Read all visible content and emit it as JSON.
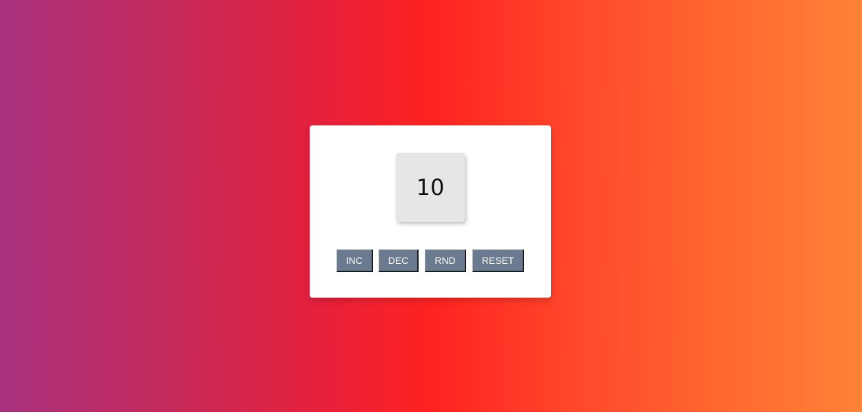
{
  "counter": {
    "value": "10"
  },
  "buttons": {
    "inc_label": "INC",
    "dec_label": "DEC",
    "rnd_label": "RND",
    "reset_label": "RESET"
  },
  "colors": {
    "gradient_start": "#a8307e",
    "gradient_mid": "#ff2220",
    "gradient_end": "#ff8236",
    "button_bg": "#6b7a8f",
    "counter_bg": "#e6e6e6",
    "card_bg": "#ffffff"
  }
}
